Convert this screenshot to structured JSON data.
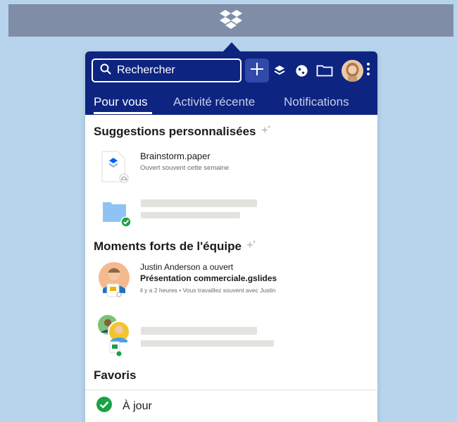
{
  "window": {
    "logo_icon": "dropbox-logo-icon"
  },
  "header": {
    "search_placeholder": "Rechercher",
    "actions": [
      "plus-icon",
      "layers-icon",
      "globe-icon",
      "folder-icon"
    ]
  },
  "tabs": [
    {
      "label": "Pour vous",
      "active": true
    },
    {
      "label": "Activité récente",
      "active": false
    },
    {
      "label": "Notifications",
      "active": false
    }
  ],
  "suggestions": {
    "title": "Suggestions personnalisées",
    "items": [
      {
        "name": "Brainstorm.paper",
        "subtitle": "Ouvert souvent cette semaine",
        "icon": "paper-doc-icon"
      },
      {
        "name": "",
        "subtitle": "",
        "icon": "folder-icon"
      }
    ]
  },
  "team": {
    "title": "Moments forts de l'équipe",
    "items": [
      {
        "line1": "Justin Anderson a ouvert",
        "line2": "Présentation commerciale.gslides",
        "line3": "il y a 2 heures • Vous travaillez souvent avec Justin"
      }
    ]
  },
  "favorites": {
    "title": "Favoris"
  },
  "footer": {
    "status": "À jour"
  },
  "colors": {
    "brand": "#0d2481",
    "success": "#1aa245",
    "background": "#b7d4ec"
  }
}
